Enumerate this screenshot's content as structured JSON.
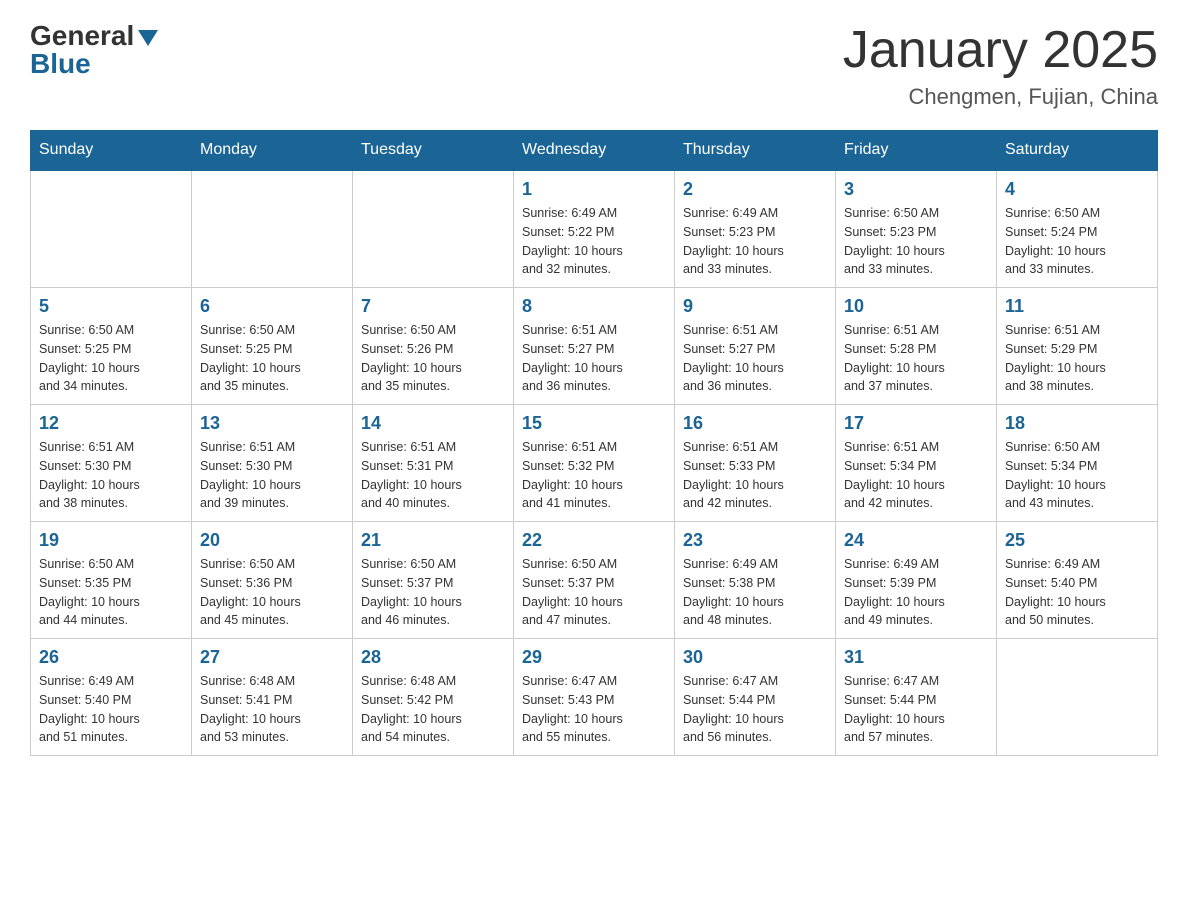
{
  "header": {
    "logo_general": "General",
    "logo_blue": "Blue",
    "title": "January 2025",
    "subtitle": "Chengmen, Fujian, China"
  },
  "days_of_week": [
    "Sunday",
    "Monday",
    "Tuesday",
    "Wednesday",
    "Thursday",
    "Friday",
    "Saturday"
  ],
  "weeks": [
    [
      {
        "day": "",
        "info": ""
      },
      {
        "day": "",
        "info": ""
      },
      {
        "day": "",
        "info": ""
      },
      {
        "day": "1",
        "info": "Sunrise: 6:49 AM\nSunset: 5:22 PM\nDaylight: 10 hours\nand 32 minutes."
      },
      {
        "day": "2",
        "info": "Sunrise: 6:49 AM\nSunset: 5:23 PM\nDaylight: 10 hours\nand 33 minutes."
      },
      {
        "day": "3",
        "info": "Sunrise: 6:50 AM\nSunset: 5:23 PM\nDaylight: 10 hours\nand 33 minutes."
      },
      {
        "day": "4",
        "info": "Sunrise: 6:50 AM\nSunset: 5:24 PM\nDaylight: 10 hours\nand 33 minutes."
      }
    ],
    [
      {
        "day": "5",
        "info": "Sunrise: 6:50 AM\nSunset: 5:25 PM\nDaylight: 10 hours\nand 34 minutes."
      },
      {
        "day": "6",
        "info": "Sunrise: 6:50 AM\nSunset: 5:25 PM\nDaylight: 10 hours\nand 35 minutes."
      },
      {
        "day": "7",
        "info": "Sunrise: 6:50 AM\nSunset: 5:26 PM\nDaylight: 10 hours\nand 35 minutes."
      },
      {
        "day": "8",
        "info": "Sunrise: 6:51 AM\nSunset: 5:27 PM\nDaylight: 10 hours\nand 36 minutes."
      },
      {
        "day": "9",
        "info": "Sunrise: 6:51 AM\nSunset: 5:27 PM\nDaylight: 10 hours\nand 36 minutes."
      },
      {
        "day": "10",
        "info": "Sunrise: 6:51 AM\nSunset: 5:28 PM\nDaylight: 10 hours\nand 37 minutes."
      },
      {
        "day": "11",
        "info": "Sunrise: 6:51 AM\nSunset: 5:29 PM\nDaylight: 10 hours\nand 38 minutes."
      }
    ],
    [
      {
        "day": "12",
        "info": "Sunrise: 6:51 AM\nSunset: 5:30 PM\nDaylight: 10 hours\nand 38 minutes."
      },
      {
        "day": "13",
        "info": "Sunrise: 6:51 AM\nSunset: 5:30 PM\nDaylight: 10 hours\nand 39 minutes."
      },
      {
        "day": "14",
        "info": "Sunrise: 6:51 AM\nSunset: 5:31 PM\nDaylight: 10 hours\nand 40 minutes."
      },
      {
        "day": "15",
        "info": "Sunrise: 6:51 AM\nSunset: 5:32 PM\nDaylight: 10 hours\nand 41 minutes."
      },
      {
        "day": "16",
        "info": "Sunrise: 6:51 AM\nSunset: 5:33 PM\nDaylight: 10 hours\nand 42 minutes."
      },
      {
        "day": "17",
        "info": "Sunrise: 6:51 AM\nSunset: 5:34 PM\nDaylight: 10 hours\nand 42 minutes."
      },
      {
        "day": "18",
        "info": "Sunrise: 6:50 AM\nSunset: 5:34 PM\nDaylight: 10 hours\nand 43 minutes."
      }
    ],
    [
      {
        "day": "19",
        "info": "Sunrise: 6:50 AM\nSunset: 5:35 PM\nDaylight: 10 hours\nand 44 minutes."
      },
      {
        "day": "20",
        "info": "Sunrise: 6:50 AM\nSunset: 5:36 PM\nDaylight: 10 hours\nand 45 minutes."
      },
      {
        "day": "21",
        "info": "Sunrise: 6:50 AM\nSunset: 5:37 PM\nDaylight: 10 hours\nand 46 minutes."
      },
      {
        "day": "22",
        "info": "Sunrise: 6:50 AM\nSunset: 5:37 PM\nDaylight: 10 hours\nand 47 minutes."
      },
      {
        "day": "23",
        "info": "Sunrise: 6:49 AM\nSunset: 5:38 PM\nDaylight: 10 hours\nand 48 minutes."
      },
      {
        "day": "24",
        "info": "Sunrise: 6:49 AM\nSunset: 5:39 PM\nDaylight: 10 hours\nand 49 minutes."
      },
      {
        "day": "25",
        "info": "Sunrise: 6:49 AM\nSunset: 5:40 PM\nDaylight: 10 hours\nand 50 minutes."
      }
    ],
    [
      {
        "day": "26",
        "info": "Sunrise: 6:49 AM\nSunset: 5:40 PM\nDaylight: 10 hours\nand 51 minutes."
      },
      {
        "day": "27",
        "info": "Sunrise: 6:48 AM\nSunset: 5:41 PM\nDaylight: 10 hours\nand 53 minutes."
      },
      {
        "day": "28",
        "info": "Sunrise: 6:48 AM\nSunset: 5:42 PM\nDaylight: 10 hours\nand 54 minutes."
      },
      {
        "day": "29",
        "info": "Sunrise: 6:47 AM\nSunset: 5:43 PM\nDaylight: 10 hours\nand 55 minutes."
      },
      {
        "day": "30",
        "info": "Sunrise: 6:47 AM\nSunset: 5:44 PM\nDaylight: 10 hours\nand 56 minutes."
      },
      {
        "day": "31",
        "info": "Sunrise: 6:47 AM\nSunset: 5:44 PM\nDaylight: 10 hours\nand 57 minutes."
      },
      {
        "day": "",
        "info": ""
      }
    ]
  ]
}
